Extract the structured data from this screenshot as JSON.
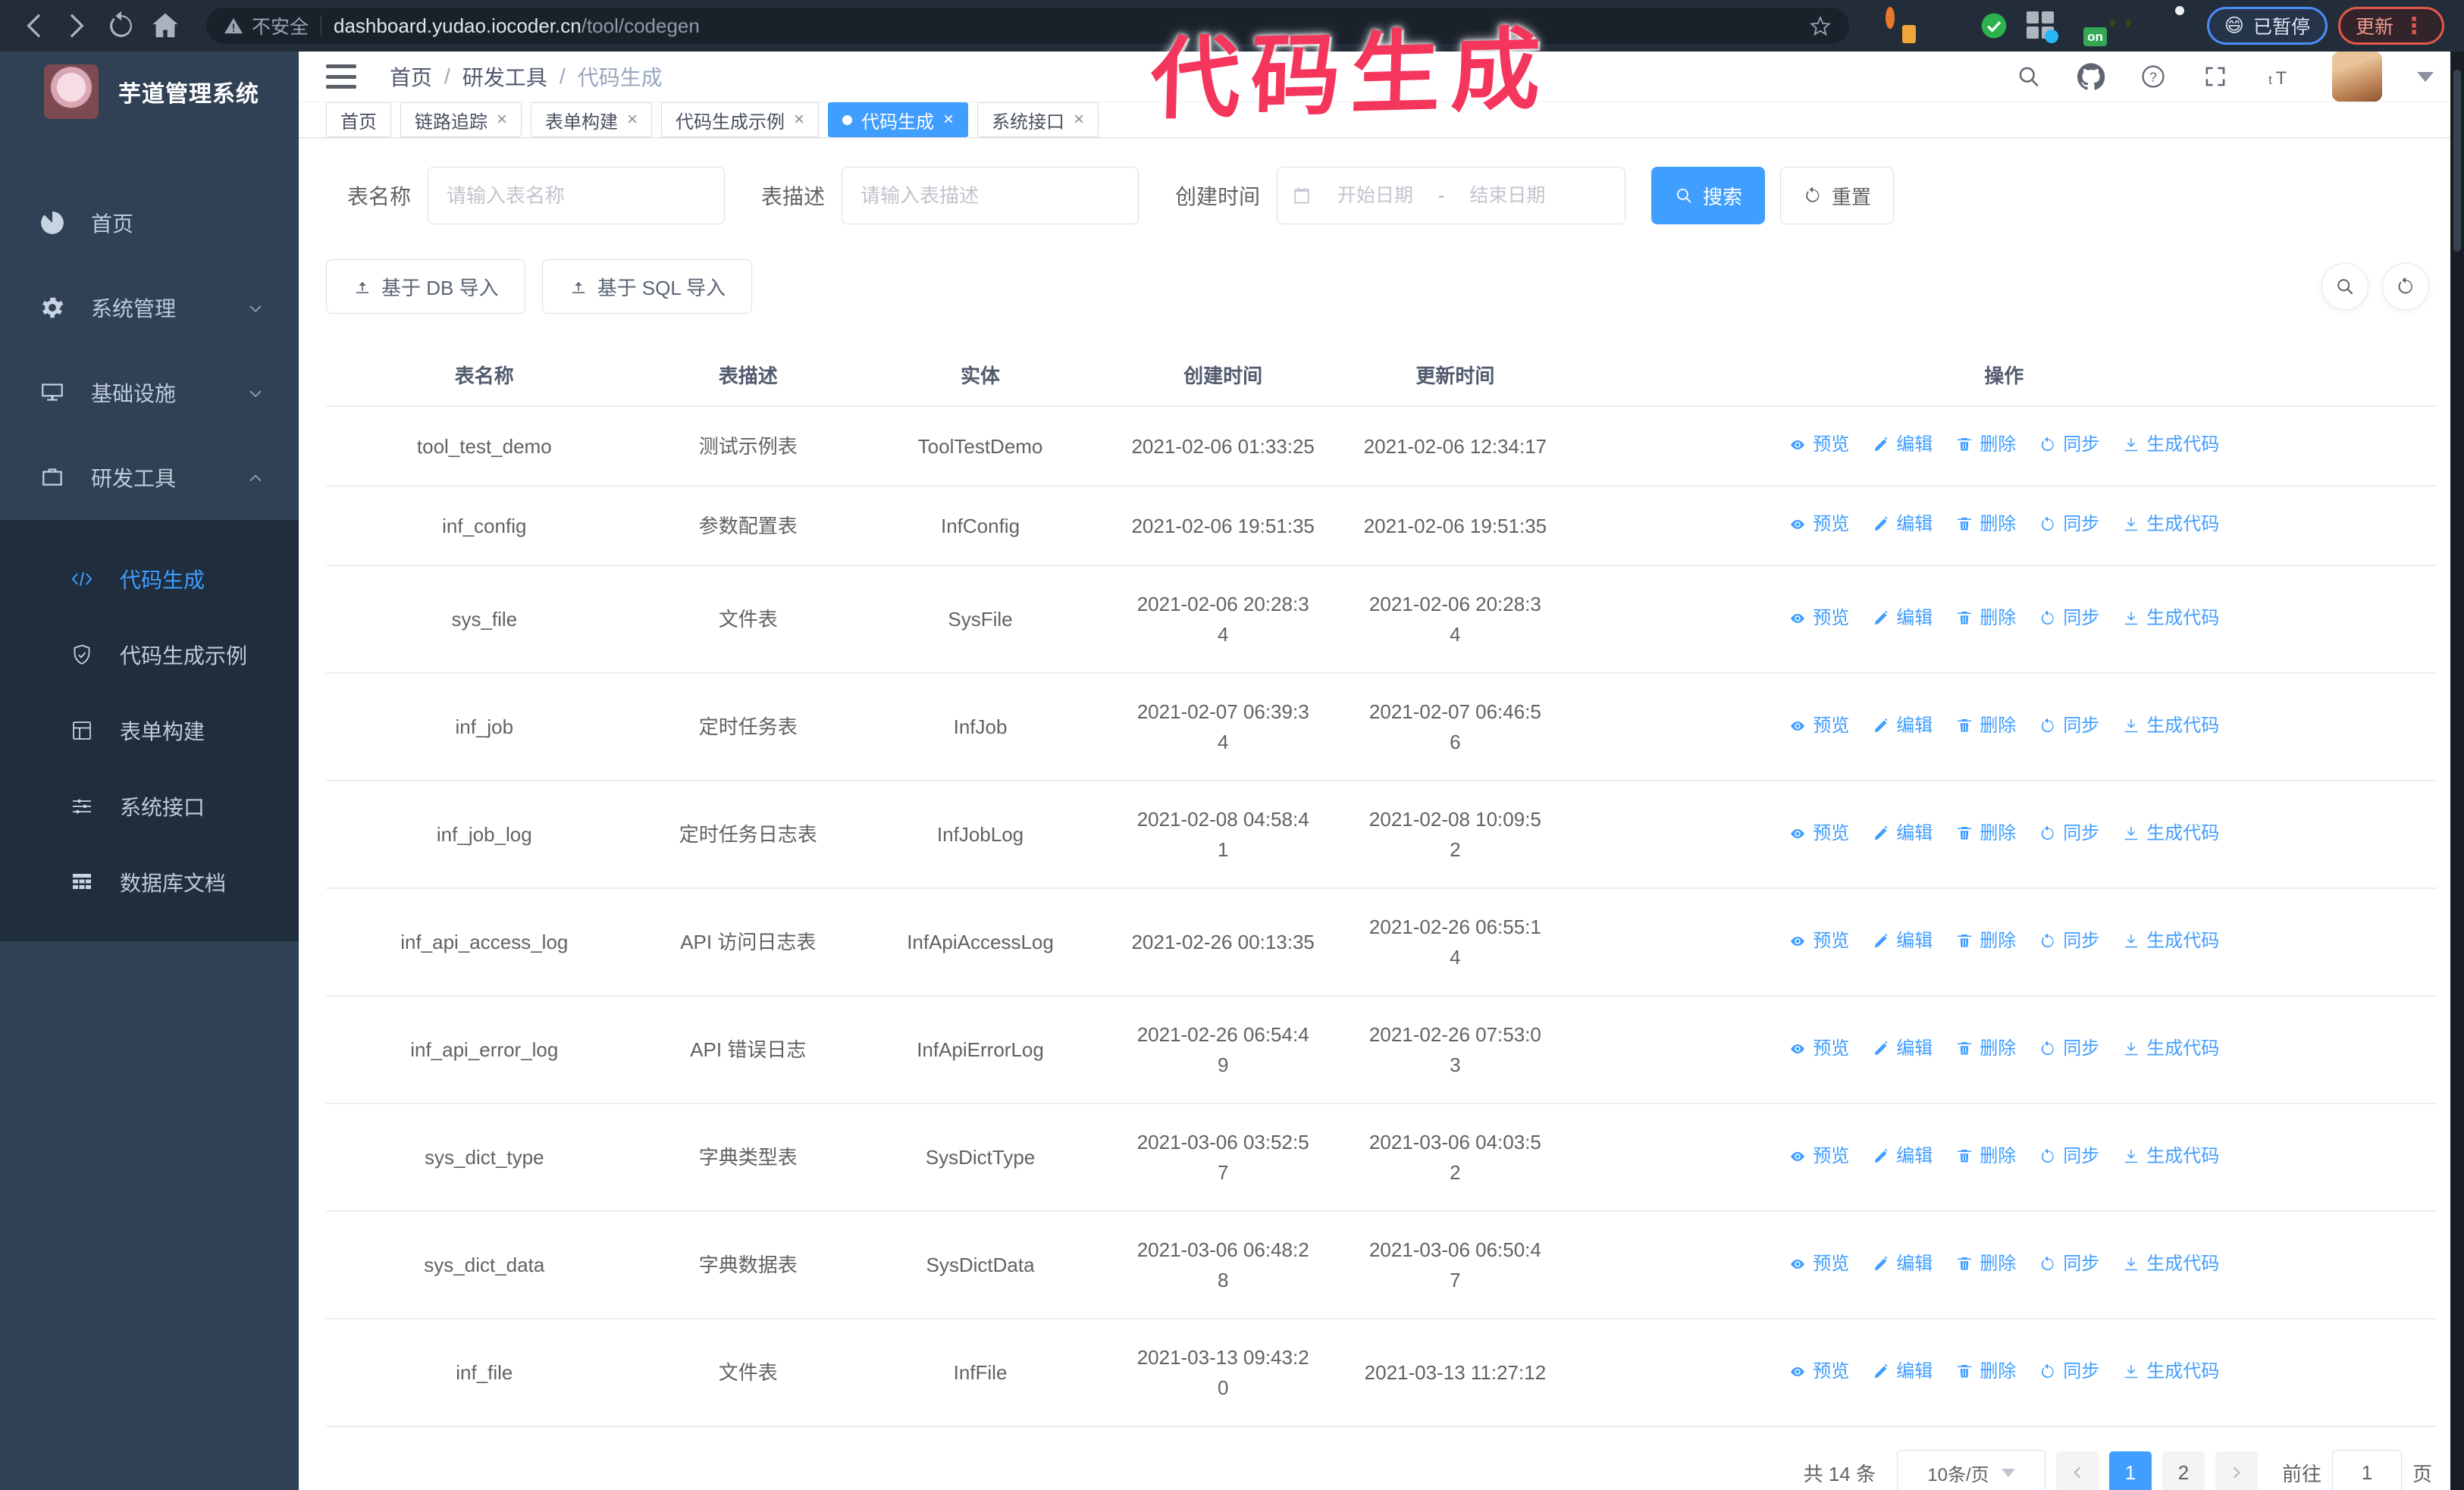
{
  "colors": {
    "accent": "#409EFF",
    "sidebar_bg": "#304156",
    "submenu_bg": "#1f2d3d",
    "annotation": "#f5365c",
    "browser_bar": "#232d39"
  },
  "browser": {
    "security_label": "不安全",
    "url_host": "dashboard.yudao.iocoder.cn",
    "url_path": "/tool/codegen",
    "paused_badge": {
      "emoji": "😄",
      "label": "已暂停"
    },
    "update_badge": {
      "label": "更新"
    },
    "extension_on_badge": "on"
  },
  "annotation": {
    "text": "代码生成"
  },
  "sidebar": {
    "title": "芋道管理系统",
    "items": [
      {
        "key": "home",
        "label": "首页",
        "icon": "dashboard",
        "expandable": false,
        "expanded": false
      },
      {
        "key": "system",
        "label": "系统管理",
        "icon": "gear",
        "expandable": true,
        "expanded": false
      },
      {
        "key": "infra",
        "label": "基础设施",
        "icon": "monitor",
        "expandable": true,
        "expanded": false
      },
      {
        "key": "devtools",
        "label": "研发工具",
        "icon": "suitcase",
        "expandable": true,
        "expanded": true
      }
    ],
    "submenu": [
      {
        "key": "codegen",
        "label": "代码生成",
        "icon": "code",
        "active": true
      },
      {
        "key": "codegen-example",
        "label": "代码生成示例",
        "icon": "shield",
        "active": false
      },
      {
        "key": "form-builder",
        "label": "表单构建",
        "icon": "form",
        "active": false
      },
      {
        "key": "system-api",
        "label": "系统接口",
        "icon": "sliders",
        "active": false
      },
      {
        "key": "db-doc",
        "label": "数据库文档",
        "icon": "dbdoc",
        "active": false
      }
    ]
  },
  "header": {
    "breadcrumb": [
      "首页",
      "研发工具",
      "代码生成"
    ],
    "breadcrumb_separator": "/"
  },
  "tabs": [
    {
      "key": "home",
      "label": "首页",
      "closable": false,
      "active": false
    },
    {
      "key": "trace",
      "label": "链路追踪",
      "closable": true,
      "active": false
    },
    {
      "key": "form-builder",
      "label": "表单构建",
      "closable": true,
      "active": false
    },
    {
      "key": "codegen-example",
      "label": "代码生成示例",
      "closable": true,
      "active": false
    },
    {
      "key": "codegen",
      "label": "代码生成",
      "closable": true,
      "active": true
    },
    {
      "key": "system-api",
      "label": "系统接口",
      "closable": true,
      "active": false
    }
  ],
  "filters": {
    "name_label": "表名称",
    "name_placeholder": "请输入表名称",
    "desc_label": "表描述",
    "desc_placeholder": "请输入表描述",
    "time_label": "创建时间",
    "start_placeholder": "开始日期",
    "range_separator": "-",
    "end_placeholder": "结束日期",
    "search_label": "搜索",
    "reset_label": "重置"
  },
  "toolbar": {
    "import_db_label": "基于 DB 导入",
    "import_sql_label": "基于 SQL 导入"
  },
  "table": {
    "columns": [
      "表名称",
      "表描述",
      "实体",
      "创建时间",
      "更新时间",
      "操作"
    ],
    "op_labels": {
      "preview": "预览",
      "edit": "编辑",
      "delete": "删除",
      "sync": "同步",
      "generate": "生成代码"
    },
    "rows": [
      {
        "name": "tool_test_demo",
        "desc": "测试示例表",
        "entity": "ToolTestDemo",
        "create_time": "2021-02-06 01:33:25",
        "update_time": "2021-02-06 12:34:17"
      },
      {
        "name": "inf_config",
        "desc": "参数配置表",
        "entity": "InfConfig",
        "create_time": "2021-02-06 19:51:35",
        "update_time": "2021-02-06 19:51:35"
      },
      {
        "name": "sys_file",
        "desc": "文件表",
        "entity": "SysFile",
        "create_time": "2021-02-06 20:28:3\n4",
        "update_time": "2021-02-06 20:28:3\n4"
      },
      {
        "name": "inf_job",
        "desc": "定时任务表",
        "entity": "InfJob",
        "create_time": "2021-02-07 06:39:3\n4",
        "update_time": "2021-02-07 06:46:5\n6"
      },
      {
        "name": "inf_job_log",
        "desc": "定时任务日志表",
        "entity": "InfJobLog",
        "create_time": "2021-02-08 04:58:4\n1",
        "update_time": "2021-02-08 10:09:5\n2"
      },
      {
        "name": "inf_api_access_log",
        "desc": "API 访问日志表",
        "entity": "InfApiAccessLog",
        "create_time": "2021-02-26 00:13:35",
        "update_time": "2021-02-26 06:55:1\n4"
      },
      {
        "name": "inf_api_error_log",
        "desc": "API 错误日志",
        "entity": "InfApiErrorLog",
        "create_time": "2021-02-26 06:54:4\n9",
        "update_time": "2021-02-26 07:53:0\n3"
      },
      {
        "name": "sys_dict_type",
        "desc": "字典类型表",
        "entity": "SysDictType",
        "create_time": "2021-03-06 03:52:5\n7",
        "update_time": "2021-03-06 04:03:5\n2"
      },
      {
        "name": "sys_dict_data",
        "desc": "字典数据表",
        "entity": "SysDictData",
        "create_time": "2021-03-06 06:48:2\n8",
        "update_time": "2021-03-06 06:50:4\n7"
      },
      {
        "name": "inf_file",
        "desc": "文件表",
        "entity": "InfFile",
        "create_time": "2021-03-13 09:43:2\n0",
        "update_time": "2021-03-13 11:27:12"
      }
    ]
  },
  "pagination": {
    "total_label": "共 14 条",
    "page_size_label": "10条/页",
    "pages": [
      "1",
      "2"
    ],
    "active_page": "1",
    "goto_label": "前往",
    "goto_value": "1",
    "page_unit_label": "页"
  }
}
